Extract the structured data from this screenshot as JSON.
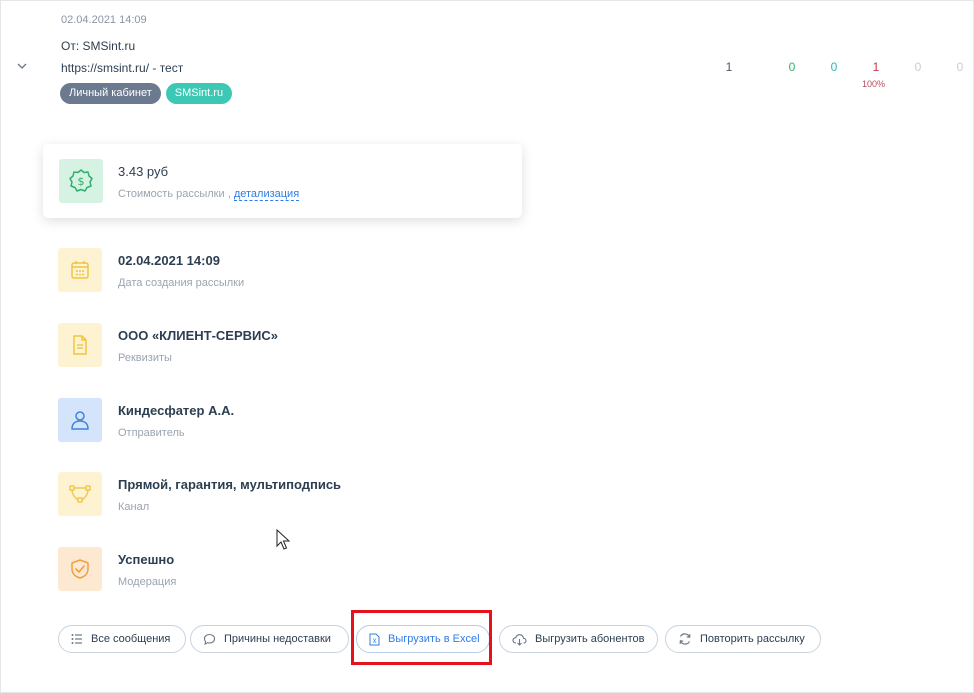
{
  "header": {
    "date": "02.04.2021 14:09",
    "from": "От: SMSint.ru",
    "url_line": "https://smsint.ru/ - тест",
    "tags": [
      "Личный кабинет",
      "SMSint.ru"
    ]
  },
  "stats": [
    {
      "value": "1",
      "color": "#4a5568"
    },
    {
      "value": "0",
      "color": "#2fb36b"
    },
    {
      "value": "0",
      "color": "#2bb4c4"
    },
    {
      "value": "1",
      "color": "#c23a4a"
    },
    {
      "value": "0",
      "color": "#c8cdd4"
    },
    {
      "value": "0",
      "color": "#c8cdd4"
    }
  ],
  "stat_percent": "100%",
  "cost": {
    "amount": "3.43 руб",
    "label": "Стоимость рассылки ,",
    "link": "детализация",
    "icon": "money-badge-icon"
  },
  "details": [
    {
      "title": "02.04.2021 14:09",
      "subtitle": "Дата создания рассылки",
      "icon": "calendar-icon",
      "bg": "#fdf3d3",
      "fg": "#f0c43c"
    },
    {
      "title": "ООО «КЛИЕНТ-СЕРВИС»",
      "subtitle": "Реквизиты",
      "icon": "document-icon",
      "bg": "#fdf3d3",
      "fg": "#f0c43c"
    },
    {
      "title": "Киндесфатер А.А.",
      "subtitle": "Отправитель",
      "icon": "user-icon",
      "bg": "#d3e4fb",
      "fg": "#3d82de"
    },
    {
      "title": "Прямой, гарантия, мультиподпись",
      "subtitle": "Канал",
      "icon": "vector-path-icon",
      "bg": "#fdf3d3",
      "fg": "#f0c43c"
    },
    {
      "title": "Успешно",
      "subtitle": "Модерация",
      "icon": "shield-check-icon",
      "bg": "#fde9d2",
      "fg": "#f0a040"
    }
  ],
  "buttons": {
    "all_messages": "Все сообщения",
    "reasons": "Причины недоставки",
    "excel": "Выгрузить в Excel",
    "subscribers": "Выгрузить абонентов",
    "repeat": "Повторить рассылку"
  },
  "colors": {
    "accent_blue": "#2f7ce6",
    "highlight_red": "#e5121c",
    "tag_gray": "#6c7a8f",
    "tag_teal": "#3cc8b4"
  }
}
